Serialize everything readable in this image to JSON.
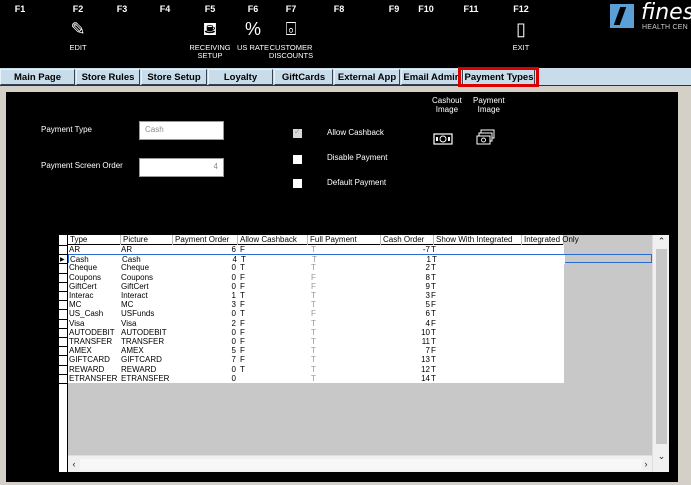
{
  "toolbar": {
    "keys": [
      {
        "code": "F1",
        "label": "",
        "icon": ""
      },
      {
        "code": "F2",
        "label": "EDIT",
        "icon": "edit-icon"
      },
      {
        "code": "F3",
        "label": "",
        "icon": ""
      },
      {
        "code": "F4",
        "label": "",
        "icon": ""
      },
      {
        "code": "F5",
        "label": "RECEIVING\nSETUP",
        "icon": "receiving-icon"
      },
      {
        "code": "F6",
        "label": "US RATE",
        "icon": "percent-icon"
      },
      {
        "code": "F7",
        "label": "CUSTOMER\nDISCOUNTS",
        "icon": "discount-icon"
      },
      {
        "code": "F8",
        "label": "",
        "icon": ""
      },
      {
        "code": "F9",
        "label": "",
        "icon": ""
      },
      {
        "code": "F10",
        "label": "",
        "icon": ""
      },
      {
        "code": "F11",
        "label": "",
        "icon": ""
      },
      {
        "code": "F12",
        "label": "EXIT",
        "icon": "exit-door-icon"
      }
    ],
    "logo": {
      "name": "finest",
      "tagline": "HEALTH CEN"
    }
  },
  "tabs": [
    {
      "label": "Main Page"
    },
    {
      "label": "Store Rules"
    },
    {
      "label": "Store Setup"
    },
    {
      "label": "Loyalty"
    },
    {
      "label": "GiftCards"
    },
    {
      "label": "External App"
    },
    {
      "label": "Email Admin"
    },
    {
      "label": "Payment Types",
      "active": true
    }
  ],
  "form": {
    "payment_type_label": "Payment Type",
    "payment_type_value": "Cash",
    "screen_order_label": "Payment Screen Order",
    "screen_order_value": "4",
    "allow_cashback_label": "Allow Cashback",
    "disable_payment_label": "Disable Payment",
    "default_payment_label": "Default Payment",
    "cashout_image_label": "Cashout\nImage",
    "payment_image_label": "Payment\nImage"
  },
  "grid": {
    "columns": [
      "Type",
      "Picture",
      "Payment Order",
      "Allow Cashback",
      "Full Payment",
      "Cash Order",
      "Show With Integrated",
      "Integrated Only"
    ],
    "rows": [
      {
        "type": "AR",
        "picture": "AR",
        "order": "6",
        "cashback": "F",
        "full": "T",
        "cash_order": "-7",
        "show": "T"
      },
      {
        "type": "Cash",
        "picture": "Cash",
        "order": "4",
        "cashback": "T",
        "full": "T",
        "cash_order": "1",
        "show": "T",
        "selected": true
      },
      {
        "type": "Cheque",
        "picture": "Cheque",
        "order": "0",
        "cashback": "T",
        "full": "T",
        "cash_order": "2",
        "show": "T"
      },
      {
        "type": "Coupons",
        "picture": "Coupons",
        "order": "0",
        "cashback": "F",
        "full": "F",
        "cash_order": "8",
        "show": "T"
      },
      {
        "type": "GiftCert",
        "picture": "GiftCert",
        "order": "0",
        "cashback": "F",
        "full": "F",
        "cash_order": "9",
        "show": "T"
      },
      {
        "type": "Interac",
        "picture": "Interact",
        "order": "1",
        "cashback": "T",
        "full": "T",
        "cash_order": "3",
        "show": "F"
      },
      {
        "type": "MC",
        "picture": "MC",
        "order": "3",
        "cashback": "F",
        "full": "T",
        "cash_order": "5",
        "show": "F"
      },
      {
        "type": "US_Cash",
        "picture": "USFunds",
        "order": "0",
        "cashback": "T",
        "full": "F",
        "cash_order": "6",
        "show": "T"
      },
      {
        "type": "Visa",
        "picture": "Visa",
        "order": "2",
        "cashback": "F",
        "full": "T",
        "cash_order": "4",
        "show": "F"
      },
      {
        "type": "AUTODEBIT",
        "picture": "AUTODEBIT",
        "order": "0",
        "cashback": "F",
        "full": "T",
        "cash_order": "10",
        "show": "T"
      },
      {
        "type": "TRANSFER",
        "picture": "TRANSFER",
        "order": "0",
        "cashback": "F",
        "full": "T",
        "cash_order": "11",
        "show": "T"
      },
      {
        "type": "AMEX",
        "picture": "AMEX",
        "order": "5",
        "cashback": "F",
        "full": "T",
        "cash_order": "7",
        "show": "F"
      },
      {
        "type": "GIFTCARD",
        "picture": "GIFTCARD",
        "order": "7",
        "cashback": "F",
        "full": "T",
        "cash_order": "13",
        "show": "T"
      },
      {
        "type": "REWARD",
        "picture": "REWARD",
        "order": "0",
        "cashback": "T",
        "full": "T",
        "cash_order": "12",
        "show": "T"
      },
      {
        "type": "ETRANSFER",
        "picture": "ETRANSFER",
        "order": "0",
        "cashback": "",
        "full": "T",
        "cash_order": "14",
        "show": "T"
      }
    ]
  },
  "colors": {
    "highlight": "#d00000",
    "tab_bg": "#c8dde9",
    "selection": "#2a6bd1"
  }
}
